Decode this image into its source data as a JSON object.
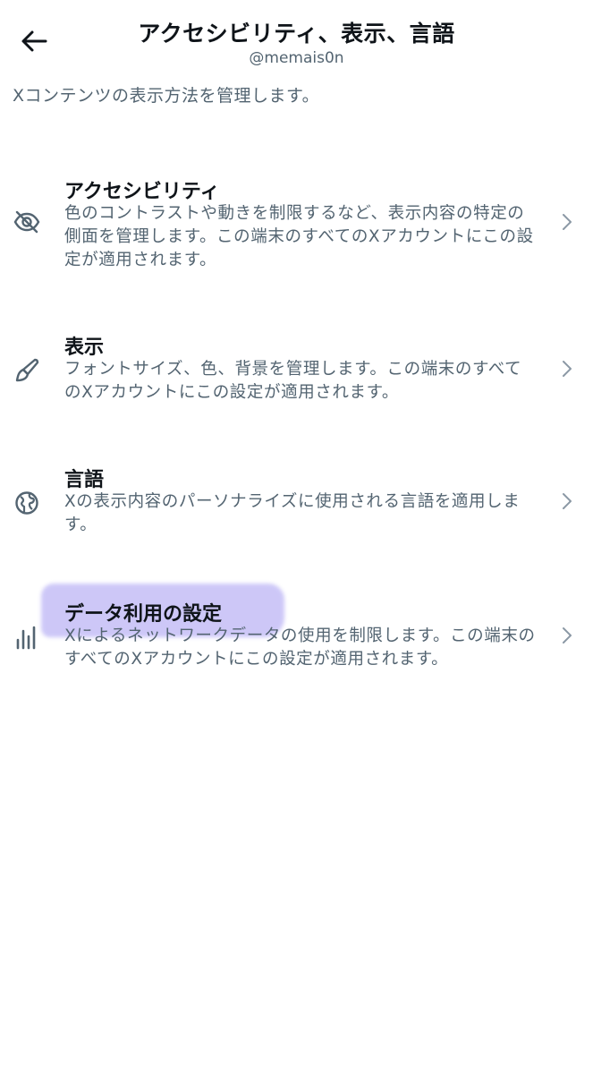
{
  "header": {
    "title": "アクセシビリティ、表示、言語",
    "subtitle": "@memais0n",
    "back_icon": "arrow-left-icon"
  },
  "intro": "Xコンテンツの表示方法を管理します。",
  "items": [
    {
      "title": "アクセシビリティ",
      "description": "色のコントラストや動きを制限するなど、表示内容の特定の側面を管理します。この端末のすべてのXアカウントにこの設定が適用されます。",
      "icon": "eye-off-icon"
    },
    {
      "title": "表示",
      "description": "フォントサイズ、色、背景を管理します。この端末のすべてのXアカウントにこの設定が適用されます。",
      "icon": "brush-icon"
    },
    {
      "title": "言語",
      "description": "Xの表示内容のパーソナライズに使用される言語を適用します。",
      "icon": "globe-icon"
    },
    {
      "title": "データ利用の設定",
      "description": "Xによるネットワークデータの使用を制限します。この端末のすべてのXアカウントにこの設定が適用されます。",
      "icon": "bar-chart-icon"
    }
  ],
  "colors": {
    "text_primary": "#0f1419",
    "text_secondary": "#536471",
    "chevron": "#8b98a5",
    "highlight": "#c8c2f7"
  }
}
